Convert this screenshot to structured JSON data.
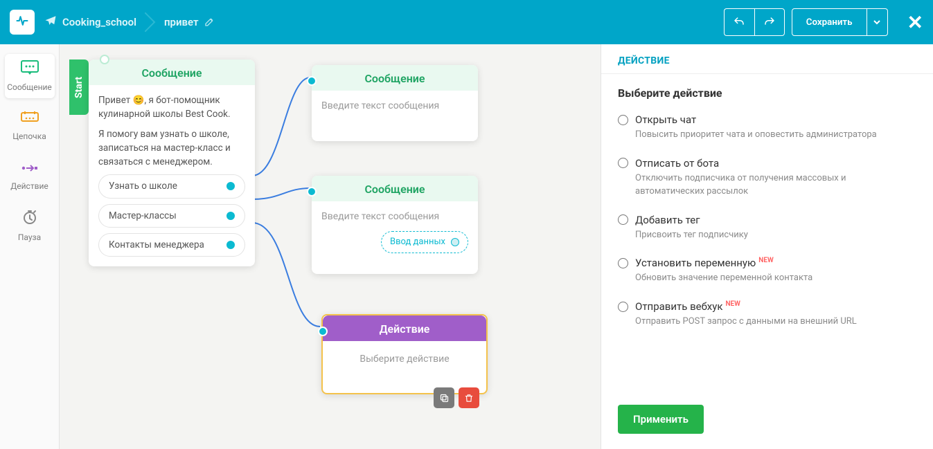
{
  "header": {
    "bot_name": "Cooking_school",
    "flow_name": "привет",
    "save_label": "Сохранить"
  },
  "rail": {
    "message": "Сообщение",
    "chain": "Цепочка",
    "action": "Действие",
    "pause": "Пауза"
  },
  "canvas": {
    "start_label": "Start",
    "node_start": {
      "title": "Сообщение",
      "text_a": "Привет 😊, я бот-помощник кулинарной школы Best Cook.",
      "text_b": "Я помогу вам узнать о школе, записаться на мастер-класс и связаться с менеджером.",
      "buttons": [
        "Узнать о школе",
        "Мастер-классы",
        "Контакты менеджера"
      ]
    },
    "node_msg1": {
      "title": "Сообщение",
      "placeholder": "Введите текст сообщения"
    },
    "node_msg2": {
      "title": "Сообщение",
      "placeholder": "Введите текст сообщения",
      "data_input": "Ввод данных"
    },
    "node_action": {
      "title": "Действие",
      "placeholder": "Выберите действие"
    }
  },
  "panel": {
    "title": "ДЕЙСТВИЕ",
    "subtitle": "Выберите действие",
    "new_label": "NEW",
    "apply": "Применить",
    "options": [
      {
        "title": "Открыть чат",
        "desc": "Повысить приоритет чата и оповестить администратора",
        "new": false
      },
      {
        "title": "Отписать от бота",
        "desc": "Отключить подписчика от получения массовых и автоматических рассылок",
        "new": false
      },
      {
        "title": "Добавить тег",
        "desc": "Присвоить тег подписчику",
        "new": false
      },
      {
        "title": "Установить переменную",
        "desc": "Обновить значение переменной контакта",
        "new": true
      },
      {
        "title": "Отправить вебхук",
        "desc": "Отправить POST запрос с данными на внешний URL",
        "new": true
      }
    ]
  }
}
